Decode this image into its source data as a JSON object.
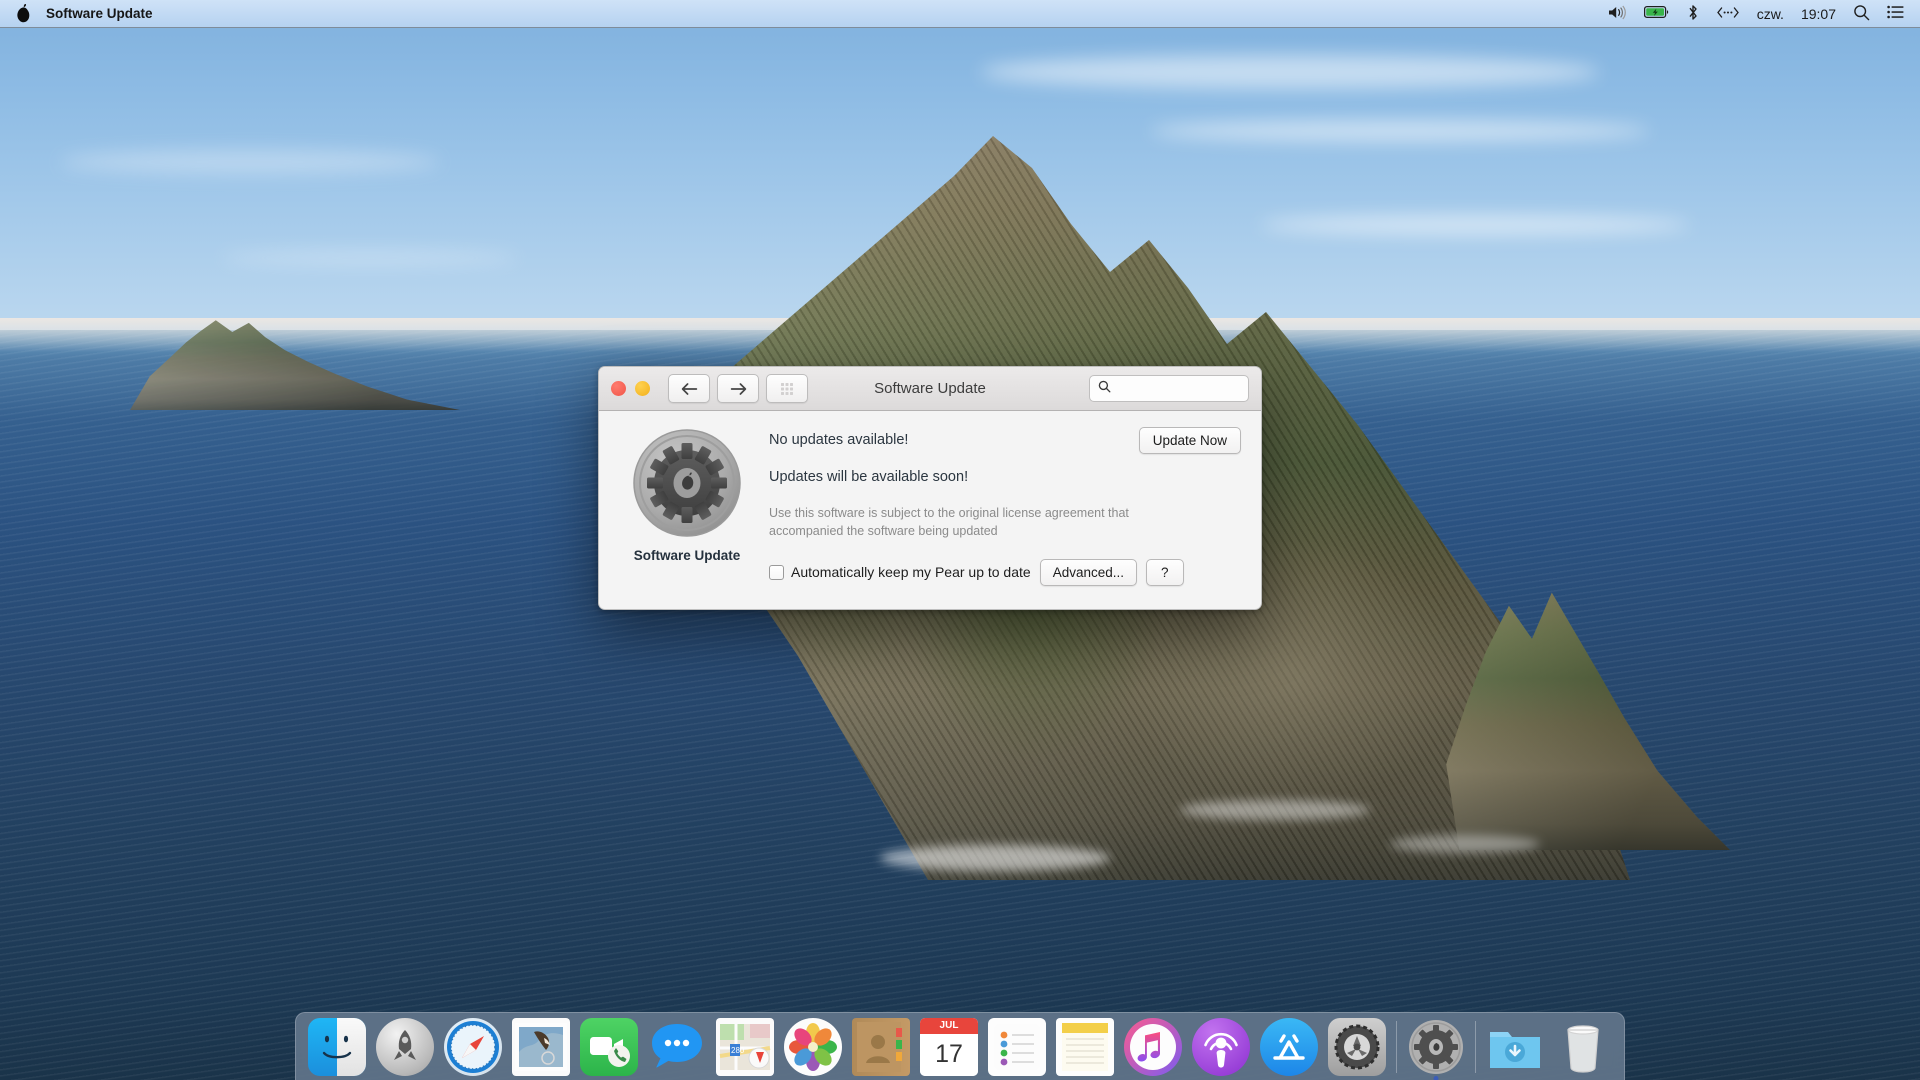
{
  "menubar": {
    "logo_icon": "pear-logo-icon",
    "app_title": "Software Update",
    "status_icons": [
      "volume-icon",
      "battery-icon",
      "bluetooth-icon",
      "airplay-display-icon"
    ],
    "day": "czw.",
    "time": "19:07",
    "search_icon": "spotlight-search-icon",
    "control_center_icon": "control-center-icon"
  },
  "window": {
    "title": "Software Update",
    "traffic_lights": [
      "close-button",
      "minimize-button"
    ],
    "nav": {
      "back_icon": "arrow-left-icon",
      "forward_icon": "arrow-right-icon",
      "grid_icon": "show-all-grid-icon"
    },
    "search": {
      "placeholder": "",
      "value": "",
      "icon": "search-icon"
    },
    "app_icon_name": "software-update-gear-icon",
    "app_caption": "Software Update",
    "status_line_1": "No updates available!",
    "status_line_2": "Updates will be available soon!",
    "license_text": "Use this software is subject to the original license agreement that accompanied the software being updated",
    "update_now_label": "Update Now",
    "checkbox": {
      "label": "Automatically keep my Pear up to date",
      "checked": false
    },
    "advanced_label": "Advanced...",
    "help_label": "?"
  },
  "dock": {
    "items": [
      {
        "name": "finder",
        "label": "Finder"
      },
      {
        "name": "launchpad",
        "label": "Launchpad"
      },
      {
        "name": "safari",
        "label": "Safari"
      },
      {
        "name": "mail",
        "label": "Mail"
      },
      {
        "name": "facetime",
        "label": "FaceTime"
      },
      {
        "name": "messages",
        "label": "Messages"
      },
      {
        "name": "maps",
        "label": "Maps"
      },
      {
        "name": "photos",
        "label": "Photos"
      },
      {
        "name": "contacts",
        "label": "Contacts"
      },
      {
        "name": "calendar",
        "label": "Calendar",
        "month": "JUL",
        "day": "17"
      },
      {
        "name": "reminders",
        "label": "Reminders"
      },
      {
        "name": "notes",
        "label": "Notes"
      },
      {
        "name": "itunes",
        "label": "iTunes"
      },
      {
        "name": "podcasts",
        "label": "Podcasts"
      },
      {
        "name": "app-store",
        "label": "App Store"
      },
      {
        "name": "system-preferences",
        "label": "System Preferences"
      },
      {
        "name": "software-update",
        "label": "Software Update",
        "running": true
      },
      {
        "name": "downloads-folder",
        "label": "Downloads"
      },
      {
        "name": "trash",
        "label": "Trash"
      }
    ]
  },
  "colors": {
    "menubar_bg": "#c2daf4",
    "window_bg": "#f4f4f4",
    "titlebar_bg": "#e4e2e2",
    "close_red": "#f05548",
    "minimize_yellow": "#f2b01c",
    "dock_bg": "#6c7e94",
    "accent_blue": "#3b5db8",
    "muted_text": "#8b8b8b"
  }
}
